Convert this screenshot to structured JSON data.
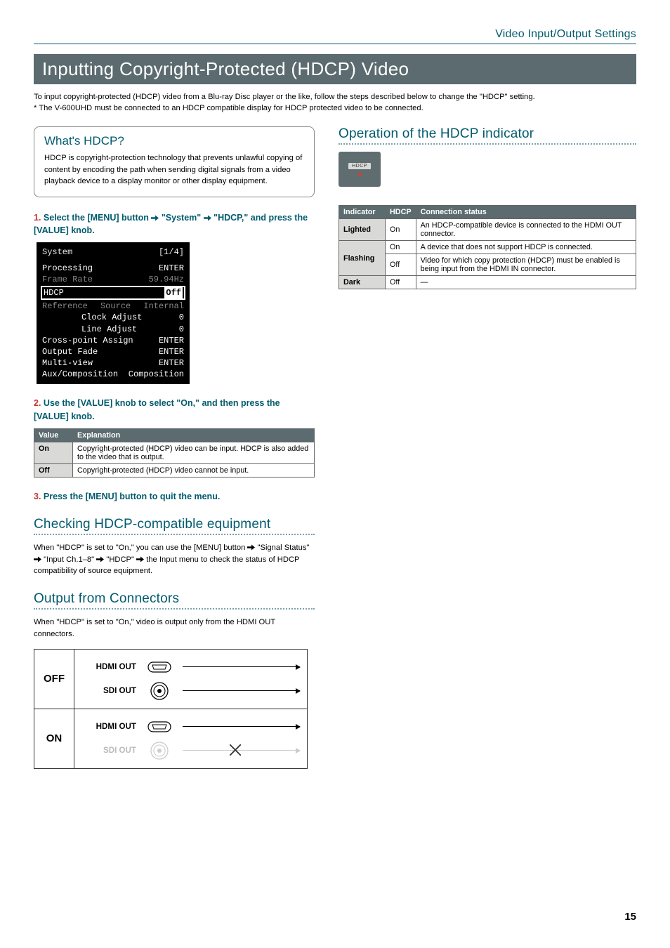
{
  "header": {
    "section_title": "Video Input/Output Settings"
  },
  "page_title": "Inputting Copyright-Protected (HDCP) Video",
  "intro": {
    "line1": "To input copyright-protected (HDCP) video from a Blu-ray Disc player or the like, follow the steps described below to change the \"HDCP\" setting.",
    "line2": "*  The V-600UHD must be connected to an HDCP compatible display for HDCP protected video to be connected."
  },
  "callout": {
    "title": "What's HDCP?",
    "text": "HDCP is copyright-protection technology that prevents unlawful copying of content by encoding the path when sending digital signals from a video playback device to a display monitor or other display equipment."
  },
  "step1": {
    "num": "1.",
    "pre": "Select the [MENU] button ",
    "a": " \"System\" ",
    "b": " \"HDCP,\" and press the [VALUE] knob."
  },
  "menu": {
    "title_l": "System",
    "title_r": "[1/4]",
    "rowA_l": "Processing",
    "rowA_r": "ENTER",
    "rowB_l": "Frame Rate",
    "rowB_r": "59.94Hz",
    "hdcp_l": "HDCP",
    "hdcp_r": "Off",
    "rowC_l": "Reference",
    "rowC_m": "Source",
    "rowC_r": "Internal",
    "rowD_l": "",
    "rowD_m": "Clock Adjust",
    "rowD_r": "0",
    "rowE_l": "",
    "rowE_m": "Line Adjust",
    "rowE_r": "0",
    "rowF_l": "Cross-point Assign",
    "rowF_r": "ENTER",
    "rowG_l": "Output Fade",
    "rowG_r": "ENTER",
    "rowH_l": "Multi-view",
    "rowH_r": "ENTER",
    "rowI_l": "Aux/Composition",
    "rowI_r": "Composition"
  },
  "step2": {
    "num": "2.",
    "text": "Use the [VALUE] knob to select \"On,\" and then press the [VALUE] knob."
  },
  "value_table": {
    "h1": "Value",
    "h2": "Explanation",
    "r1v": "On",
    "r1e": "Copyright-protected (HDCP) video can be input. HDCP is also added to the video that is output.",
    "r2v": "Off",
    "r2e": "Copyright-protected (HDCP) video cannot be input."
  },
  "step3": {
    "num": "3.",
    "text": "Press the [MENU] button to quit the menu."
  },
  "checking": {
    "title": "Checking HDCP-compatible equipment",
    "pre": "When \"HDCP\" is set to \"On,\" you can use the [MENU] button ",
    "a": "  \"Signal Status\" ",
    "b": " \"Input Ch.1–8\" ",
    "c": " \"HDCP\" ",
    "d": " the Input menu to check the status of HDCP compatibility of source equipment."
  },
  "output_conn": {
    "title": "Output from Connectors",
    "text": "When \"HDCP\" is set to \"On,\" video is output only from the HDMI OUT connectors.",
    "off_label": "OFF",
    "on_label": "ON",
    "hdmi": "HDMI OUT",
    "sdi": "SDI OUT"
  },
  "right": {
    "title": "Operation of the HDCP indicator",
    "indicator_label": "HDCP",
    "table": {
      "h1": "Indicator",
      "h2": "HDCP",
      "h3": "Connection status",
      "r1_ind": "Lighted",
      "r1_hdcp": "On",
      "r1_conn": "An HDCP-compatible device is connected to the HDMI OUT connector.",
      "r2_ind": "Flashing",
      "r2a_hdcp": "On",
      "r2a_conn": "A device that does not support HDCP is connected.",
      "r2b_hdcp": "Off",
      "r2b_conn": "Video for which copy protection (HDCP) must be enabled is being input from the HDMI IN connector.",
      "r3_ind": "Dark",
      "r3_hdcp": "Off",
      "r3_conn": "—"
    }
  },
  "page_number": "15"
}
